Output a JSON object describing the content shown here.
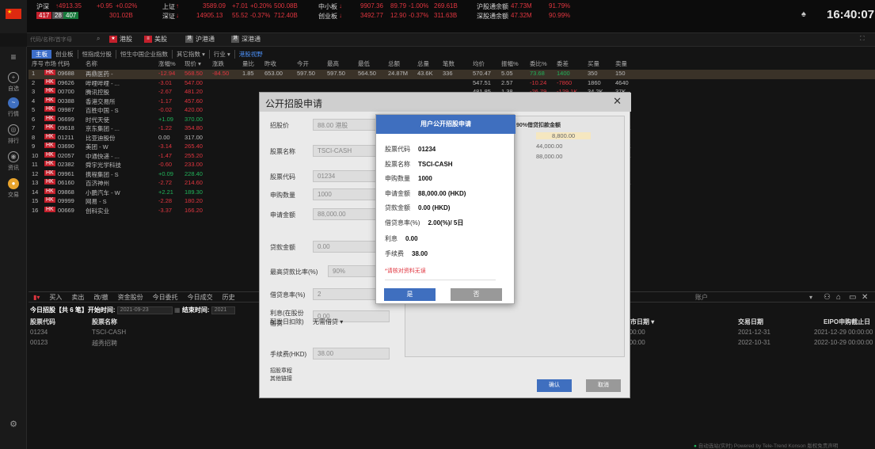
{
  "topbar": {
    "sh_label": "沪深",
    "sh_index": "4913.35",
    "sh_chg": "+0.95",
    "sh_pct": "+0.02%",
    "breadth_up": "417",
    "breadth_flat": "28",
    "breadth_down": "407",
    "turnover": "301.02B",
    "sz_label": "上证",
    "sz_val": "3589.09",
    "sz_chg": "+7.01",
    "sz_pct": "+0.20%",
    "sz_amt": "500.08B",
    "szc_label": "深证",
    "szc_val": "14905.13",
    "szc_chg": "55.52",
    "szc_pct": "-0.37%",
    "szc_amt": "712.40B",
    "zxb_label": "中小板",
    "zxb_val": "9907.36",
    "zxb_chg": "89.79",
    "zxb_pct": "-1.00%",
    "zxb_amt": "269.61B",
    "cyb_label": "创业板",
    "cyb_val": "3492.77",
    "cyb_chg": "12.90",
    "cyb_pct": "-0.37%",
    "cyb_amt": "311.63B",
    "hgt_label": "沪股通余额",
    "hgt_val": "47.73M",
    "hgt_pct": "91.79%",
    "sgt_label": "深股通余额",
    "sgt_val": "47.32M",
    "sgt_pct": "90.99%",
    "clock": "16:40:07"
  },
  "subbar": {
    "search_placeholder": "代码/名称/首字母",
    "markets": [
      {
        "label": "港股",
        "color": "#c4202c",
        "icon": "star-icon"
      },
      {
        "label": "美股",
        "color": "#c4202c",
        "icon": "us-flag-icon"
      },
      {
        "label": "沪港通",
        "color": "#555555",
        "icon": "hk-icon"
      },
      {
        "label": "深港通",
        "color": "#555555",
        "icon": "hk-icon"
      }
    ]
  },
  "sidebar": {
    "items": [
      {
        "label": "自选",
        "icon": "plus-icon"
      },
      {
        "label": "行情",
        "icon": "chart-icon"
      },
      {
        "label": "排行",
        "icon": "rank-icon"
      },
      {
        "label": "资讯",
        "icon": "news-icon"
      },
      {
        "label": "交易",
        "icon": "trade-icon"
      }
    ]
  },
  "tabs": [
    "主板",
    "创业板",
    "恒指成分股",
    "恒生中国企业指数",
    "其它指数 ▾",
    "行业 ▾",
    "港股视野"
  ],
  "table": {
    "headers": [
      "序号",
      "市场",
      "代码",
      "名称",
      "涨幅%",
      "现价 ▾",
      "涨跌",
      "量比",
      "昨收",
      "今开",
      "最高",
      "最低",
      "总额",
      "总量",
      "笔数",
      "均价",
      "振幅%",
      "委比%",
      "委差",
      "买量",
      "卖量"
    ],
    "rows": [
      [
        "1",
        "HK",
        "09688",
        "再鼎医药 -",
        "-12.94",
        "568.50",
        "-84.50",
        "1.85",
        "653.00",
        "597.50",
        "597.50",
        "564.50",
        "24.87M",
        "43.6K",
        "336",
        "570.47",
        "5.05",
        "73.68",
        "1400",
        "350",
        "150"
      ],
      [
        "2",
        "HK",
        "09626",
        "哔哩哔哩 - ...",
        "-3.01",
        "547.00",
        "",
        "",
        "",
        "",
        "",
        "",
        "",
        "",
        "",
        "547.51",
        "2.57",
        "-10.24",
        "-7860",
        "1860",
        "4640"
      ],
      [
        "3",
        "HK",
        "00700",
        "腾讯控股",
        "-2.67",
        "481.20",
        "",
        "",
        "",
        "",
        "",
        "",
        "",
        "",
        "",
        "481.85",
        "1.38",
        "-26.79",
        "-129.1K",
        "34.2K",
        "37K"
      ],
      [
        "4",
        "HK",
        "00388",
        "香港交易所",
        "-1.17",
        "457.60",
        "",
        "",
        "",
        "",
        "",
        "",
        "",
        "",
        "",
        "458.22",
        "1.04",
        "-9.42",
        "-28.4K",
        "19.1K",
        "2500"
      ],
      [
        "5",
        "HK",
        "09987",
        "百胜中国 - S",
        "-0.02",
        "420.00",
        "",
        "",
        "",
        "",
        "",
        "",
        "",
        "",
        "",
        "417.58",
        "2.00",
        "-52.63",
        "-1000",
        "50",
        "350"
      ],
      [
        "6",
        "HK",
        "06699",
        "时代天使",
        "+1.09",
        "370.00",
        "",
        "",
        "",
        "",
        "",
        "",
        "",
        "",
        "",
        "371.73",
        "3.01",
        "60.00",
        "600",
        "200",
        "200"
      ],
      [
        "7",
        "HK",
        "09618",
        "京东集团 - ...",
        "-1.22",
        "354.80",
        "",
        "",
        "",
        "",
        "",
        "",
        "",
        "",
        "",
        "353.28",
        "3.79",
        "-51.44",
        "-262.5K",
        "23.5K",
        "69.4K"
      ],
      [
        "8",
        "HK",
        "01211",
        "比亚迪股份",
        "0.00",
        "317.00",
        "",
        "",
        "",
        "",
        "",
        "",
        "",
        "",
        "",
        "315.02",
        "2.78",
        "-84.19",
        "-303.5K",
        "1500",
        "11K"
      ],
      [
        "9",
        "HK",
        "03690",
        "美团 - W",
        "-3.14",
        "265.40",
        "",
        "",
        "",
        "",
        "",
        "",
        "",
        "",
        "",
        "266.44",
        "1.53",
        "85.48",
        "1.19M",
        "131.8K",
        "46.7K"
      ],
      [
        "10",
        "HK",
        "02057",
        "中通快递 - ...",
        "-1.47",
        "255.20",
        "",
        "",
        "",
        "",
        "",
        "",
        "",
        "",
        "",
        "253.90",
        "2.70",
        "-93.20",
        "-26.8K",
        "150",
        "23.8K"
      ],
      [
        "11",
        "HK",
        "02382",
        "舜宇光学科技",
        "-0.60",
        "233.00",
        "",
        "",
        "",
        "",
        "",
        "",
        "",
        "",
        "",
        "233.49",
        "2.56",
        "-40.43",
        "-128.4K",
        "1200",
        "107K"
      ],
      [
        "12",
        "HK",
        "09961",
        "携程集团 - S",
        "+0.09",
        "228.40",
        "",
        "",
        "",
        "",
        "",
        "",
        "",
        "",
        "",
        "227.83",
        "1.58",
        "5.68",
        "1450",
        "1150",
        "750"
      ],
      [
        "13",
        "HK",
        "06160",
        "百济神州",
        "-2.72",
        "214.60",
        "",
        "",
        "",
        "",
        "",
        "",
        "",
        "",
        "",
        "214.29",
        "1.90",
        "-59.35",
        "-73K",
        "2000",
        "91.9K"
      ],
      [
        "14",
        "HK",
        "09868",
        "小鹏汽车 - W",
        "+2.21",
        "189.30",
        "",
        "",
        "",
        "",
        "",
        "",
        "",
        "",
        "",
        "187.88",
        "2.92",
        "35.40",
        "8000",
        "5000",
        "2500"
      ],
      [
        "15",
        "HK",
        "09999",
        "网易 - S",
        "-2.28",
        "180.20",
        "",
        "",
        "",
        "",
        "",
        "",
        "",
        "",
        "",
        "180.19",
        "3.04",
        "-53.00",
        "-193.5K",
        "21.3K",
        "3300"
      ],
      [
        "16",
        "HK",
        "00669",
        "创科实业",
        "-3.37",
        "166.20",
        "",
        "",
        "",
        "",
        "",
        "",
        "",
        "",
        "",
        "166.14",
        "2.85",
        "39.03",
        "116.5K",
        "4000",
        "5500"
      ]
    ]
  },
  "bottom": {
    "tabs": [
      "买入",
      "卖出",
      "改/撤",
      "资金股份",
      "今日委托",
      "今日成交",
      "历史"
    ],
    "info_label": "今日招股【共 6 笔】开始时间:",
    "start_date": "2021-09-23",
    "end_label": "结束时间:",
    "end_date": "2021",
    "account_label": "账户",
    "columns": {
      "code": "股票代码",
      "name": "股票名称",
      "listdate": "上市日期 ▾",
      "tradedate": "交易日期",
      "deadline": "EIPO申购截止日"
    },
    "rows": [
      {
        "code": "01234",
        "name": "TSCI-CASH",
        "listdate": "0:00:00",
        "tradedate": "2021-12-31",
        "deadline": "2021-12-29 00:00:00"
      },
      {
        "code": "00123",
        "name": "越秀招聘",
        "listdate": "0:00:00",
        "tradedate": "2022-10-31",
        "deadline": "2022-10-29 00:00:00"
      }
    ]
  },
  "modal": {
    "title": "公开招股申请",
    "fields": [
      {
        "label": "招股价",
        "value": "88.00 港股"
      },
      {
        "label": "股票名称",
        "value": "TSCI-CASH"
      },
      {
        "label": "股票代码",
        "value": "01234"
      },
      {
        "label": "申购数量",
        "value": "1000"
      },
      {
        "label": "申请金额",
        "value": "88,000.00"
      },
      {
        "label": "贷款金额",
        "value": "0.00"
      },
      {
        "label": "最高贷款比率(%)",
        "value": "90%"
      },
      {
        "label": "借贷息率(%)",
        "value": "2"
      },
      {
        "label": "利息(在股份配发日扣除)",
        "value": "0.00"
      },
      {
        "label": "手续费(HKD)",
        "value": "38.00"
      }
    ],
    "loan_label": "借贷",
    "loan_select": "无需借贷 ▾",
    "extra1": "招股章程",
    "extra2": "其他链接",
    "table_header": "90%借贷扣款金额",
    "table_values": [
      "8,800.00",
      "44,000.00",
      "88,000.00"
    ],
    "confirm": "确认",
    "cancel": "取消"
  },
  "dialog": {
    "title": "用户公开招股申请",
    "lines": [
      {
        "label": "股票代码",
        "value": "01234"
      },
      {
        "label": "股票名称",
        "value": "TSCI-CASH"
      },
      {
        "label": "申购数量",
        "value": "1000"
      },
      {
        "label": "申请金额",
        "value": "88,000.00 (HKD)"
      },
      {
        "label": "贷款金额",
        "value": "0.00 (HKD)"
      },
      {
        "label": "借贷息率(%)",
        "value": "2.00(%)/ 5日"
      },
      {
        "label": "利息",
        "value": "0.00"
      },
      {
        "label": "手续费",
        "value": "38.00"
      }
    ],
    "warning": "*请核对资料无误",
    "yes": "是",
    "no": "否"
  },
  "footer": {
    "text": "自动选站(实时)  Powered by Tele-Trend Konson  版权免责声明"
  },
  "colors": {
    "up": "#e0353f",
    "down": "#21b35a",
    "accent": "#3f6fbf"
  }
}
